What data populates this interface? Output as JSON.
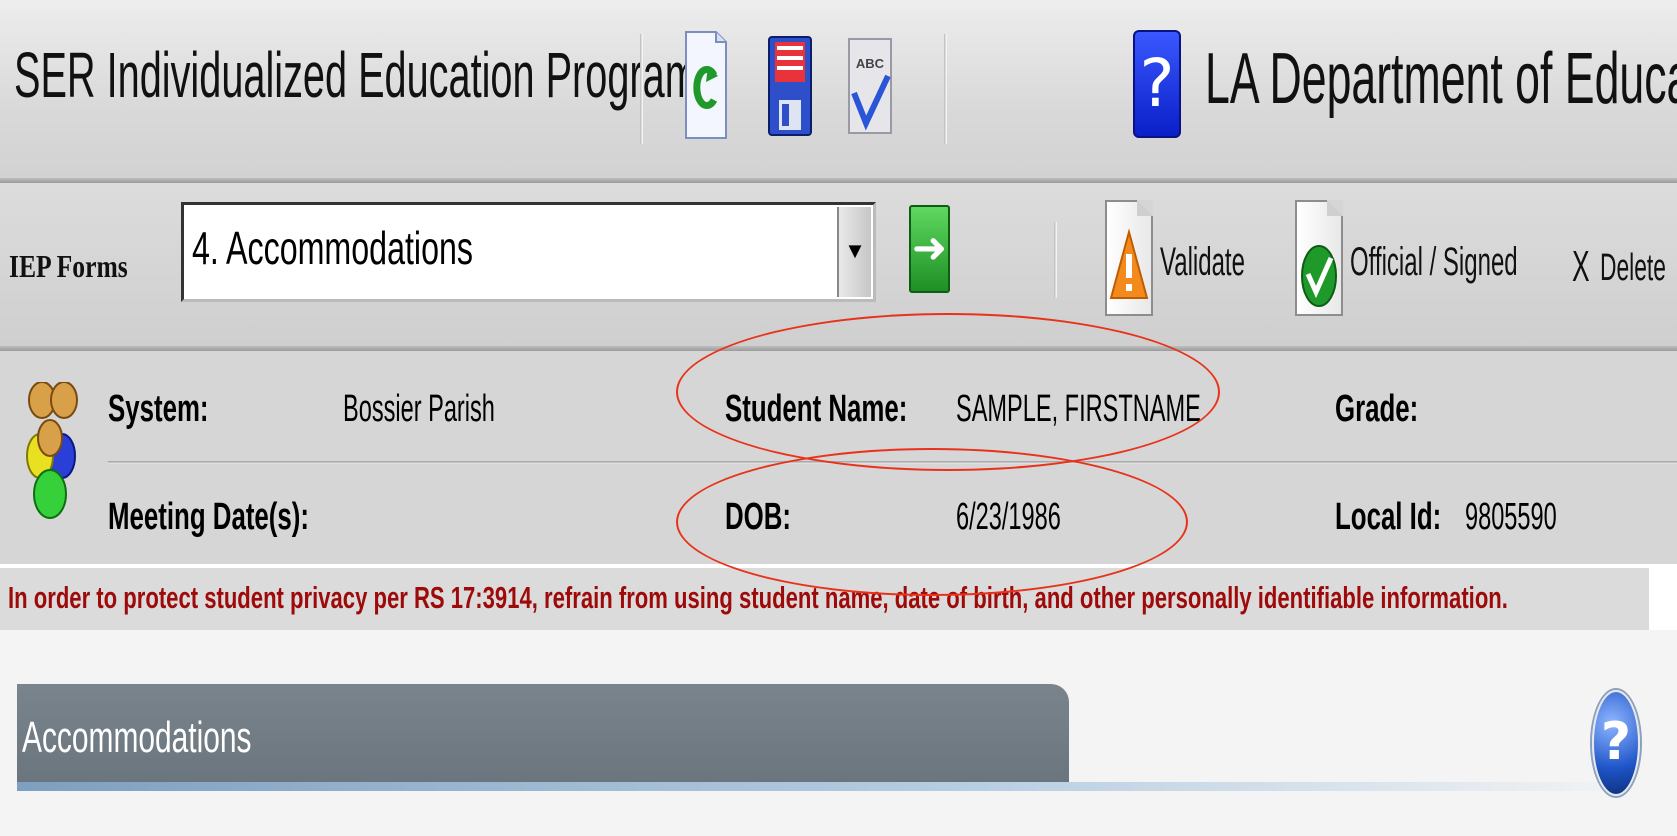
{
  "header": {
    "app_title": "SER Individualized Education Program",
    "dept_title": "LA Department of Educatio",
    "toolbar_icons": [
      "refresh-icon",
      "save-icon",
      "spellcheck-icon",
      "help-icon"
    ],
    "spellcheck_glyph": "ABC",
    "help_glyph": "?"
  },
  "forms_bar": {
    "label": "IEP Forms",
    "selected_form": "4. Accommodations",
    "dropdown_glyph": "▼",
    "go_glyph": "➜",
    "validate_label": "Validate",
    "official_label": "Official / Signed",
    "delete_glyph": "X",
    "delete_label": "Delete"
  },
  "student_info": {
    "system_label": "System:",
    "system_value": "Bossier Parish",
    "student_name_label": "Student Name:",
    "student_name_value": "SAMPLE, FIRSTNAME",
    "grade_label": "Grade:",
    "grade_value": "",
    "meeting_label": "Meeting Date(s):",
    "meeting_value": "",
    "dob_label": "DOB:",
    "dob_value": "6/23/1986",
    "local_id_label": "Local Id:",
    "local_id_value": "9805590"
  },
  "privacy_notice": "In order to protect student privacy per RS 17:3914, refrain from using student name, date of birth, and other personally identifiable information.",
  "section": {
    "title": "Accommodations",
    "help_glyph": "?"
  },
  "colors": {
    "notice_red": "#9e0a0a",
    "annotation_red": "#e8331a",
    "section_tab": "#737d85"
  }
}
